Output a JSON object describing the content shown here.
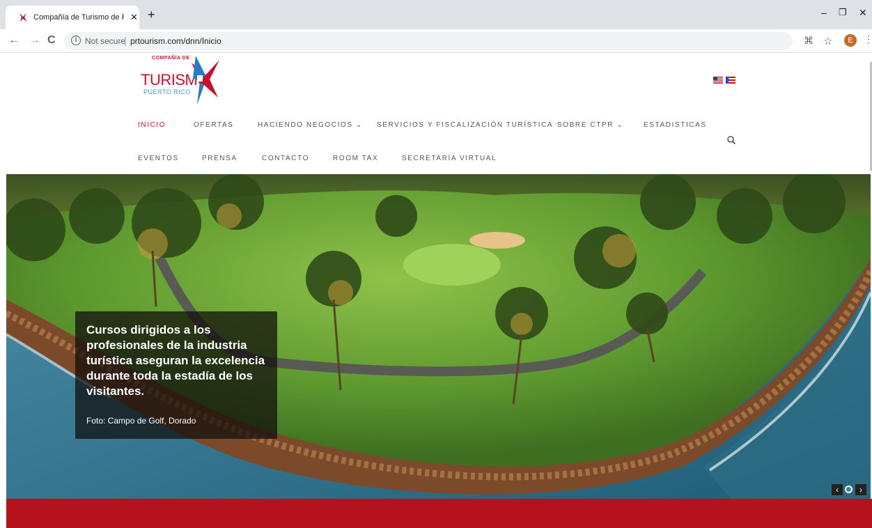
{
  "browser": {
    "tab_title": "Compañía de Turismo de Puerto",
    "tab_close": "✕",
    "new_tab": "+",
    "url_security": "Not secure",
    "url": "prtourism.com/dnn/Inicio",
    "profile_initial": "E",
    "colors": {
      "tabstrip": "#dee1e6",
      "omnibox": "#f1f3f4"
    }
  },
  "site": {
    "logo": {
      "small_text": "COMPAÑÍA DE",
      "main_text": "TURISMO",
      "sub_text": "PUERTO RICO"
    },
    "menu_row1": [
      {
        "label": "INICIO",
        "active": true
      },
      {
        "label": "OFERTAS"
      },
      {
        "label": "HACIENDO NEGOCIOS ⌄"
      },
      {
        "label": "SERVICIOS Y FISCALIZACIÓN TURÍSTICA"
      },
      {
        "label": "SOBRE CTPR ⌄"
      },
      {
        "label": "ESTADISTICAS"
      }
    ],
    "menu_row2": [
      {
        "label": "EVENTOS"
      },
      {
        "label": "PRENSA"
      },
      {
        "label": "CONTACTO"
      },
      {
        "label": "ROOM TAX"
      },
      {
        "label": "SECRETARÍA VIRTUAL"
      }
    ],
    "hero": {
      "caption_title": "Cursos dirigidos a los profesionales de la industria turística aseguran la excelencia durante toda la estadía de los visitantes.",
      "caption_credit": "Foto: Campo de Golf, Dorado"
    },
    "colors": {
      "brand_red": "#c8102e",
      "band_red": "#b5121b",
      "logo_blue": "#4a90c9"
    }
  }
}
